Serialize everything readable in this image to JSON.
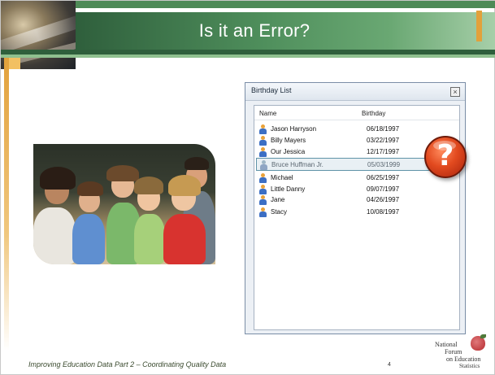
{
  "slide": {
    "title": "Is it an Error?",
    "footer": "Improving Education Data Part 2 – Coordinating Quality Data",
    "page_number": "4"
  },
  "logo": {
    "line1": "National",
    "line2": "Forum",
    "line3": "on Education",
    "line4": "Statistics"
  },
  "window": {
    "title": "Birthday List",
    "close_label": "×",
    "columns": {
      "name": "Name",
      "birthday": "Birthday"
    },
    "rows": [
      {
        "name": "Jason Harryson",
        "birthday": "06/18/1997",
        "highlighted": false
      },
      {
        "name": "Billy Mayers",
        "birthday": "03/22/1997",
        "highlighted": false
      },
      {
        "name": "Our Jessica",
        "birthday": "12/17/1997",
        "highlighted": false
      },
      {
        "name": "Bruce Huffman Jr.",
        "birthday": "05/03/1999",
        "highlighted": true
      },
      {
        "name": "Michael",
        "birthday": "06/25/1997",
        "highlighted": false
      },
      {
        "name": "Little Danny",
        "birthday": "09/07/1997",
        "highlighted": false
      },
      {
        "name": "Jane",
        "birthday": "04/26/1997",
        "highlighted": false
      },
      {
        "name": "Stacy",
        "birthday": "10/08/1997",
        "highlighted": false
      }
    ]
  },
  "badge": {
    "symbol": "?"
  },
  "colors": {
    "title_bar": "#4f8f5c",
    "accent_orange": "#e2a13b",
    "badge_red": "#e24a1f",
    "highlight_border": "#5f93a8"
  }
}
